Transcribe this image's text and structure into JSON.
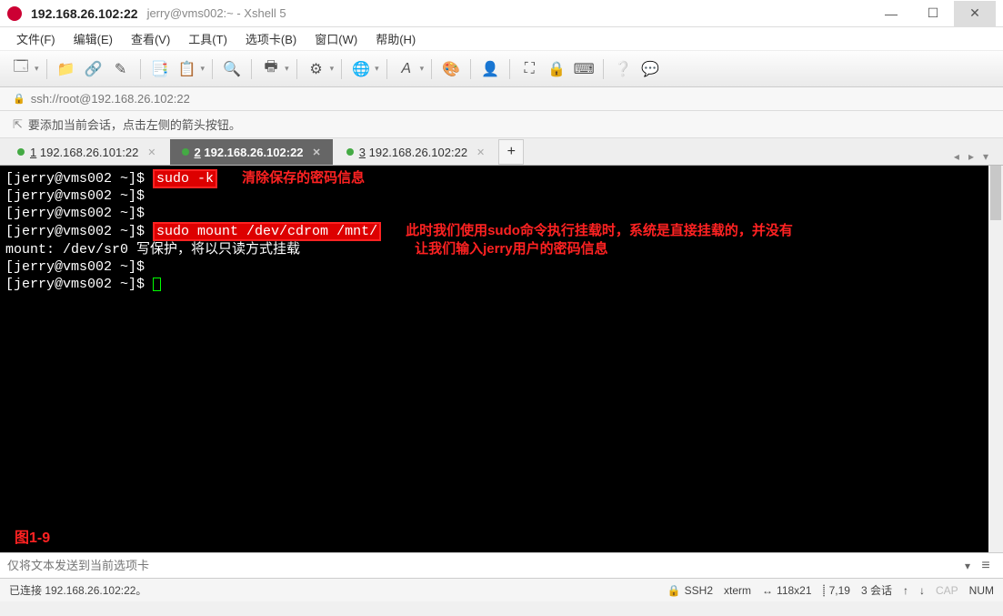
{
  "titlebar": {
    "ip": "192.168.26.102:22",
    "subtitle": "jerry@vms002:~ - Xshell 5"
  },
  "menubar": {
    "file": "文件(F)",
    "edit": "编辑(E)",
    "view": "查看(V)",
    "tools": "工具(T)",
    "tabs": "选项卡(B)",
    "window": "窗口(W)",
    "help": "帮助(H)"
  },
  "addressbar": {
    "url": "ssh://root@192.168.26.102:22"
  },
  "hintbar": {
    "text": "要添加当前会话，点击左侧的箭头按钮。"
  },
  "tabs": {
    "items": [
      {
        "num": "1",
        "label": "192.168.26.101:22",
        "active": false
      },
      {
        "num": "2",
        "label": "192.168.26.102:22",
        "active": true
      },
      {
        "num": "3",
        "label": "192.168.26.102:22",
        "active": false
      }
    ]
  },
  "terminal": {
    "prompt": "[jerry@vms002 ~]$ ",
    "cmd1": "sudo -k",
    "annot1": "清除保存的密码信息",
    "cmd2": "sudo mount /dev/cdrom /mnt/",
    "annot2a": "此时我们使用sudo命令执行挂载时，系统是直接挂载的，并没有",
    "out2": "mount: /dev/sr0 写保护，将以只读方式挂载",
    "annot2b": "让我们输入jerry用户的密码信息",
    "figure": "图1-9"
  },
  "inputbar": {
    "placeholder": "仅将文本发送到当前选项卡"
  },
  "statusbar": {
    "conn": "已连接 192.168.26.102:22。",
    "proto": "SSH2",
    "termtype": "xterm",
    "size": "118x21",
    "pos": "7,19",
    "sessions": "3 会话",
    "cap": "CAP",
    "num": "NUM"
  }
}
